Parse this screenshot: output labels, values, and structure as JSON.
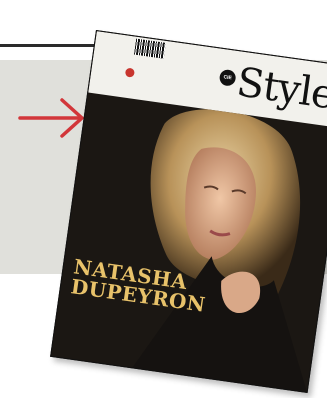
{
  "magazine": {
    "logo": "Style",
    "logo_badge": "CIE",
    "cover_name_line1": "NATASHA",
    "cover_name_line2": "DUPEYRON"
  },
  "colors": {
    "background_gray": "#e0e0db",
    "arrow_red": "#d2363a",
    "cover_gold": "#e8c26a"
  },
  "icons": {
    "arrow": "right-arrow-icon"
  }
}
